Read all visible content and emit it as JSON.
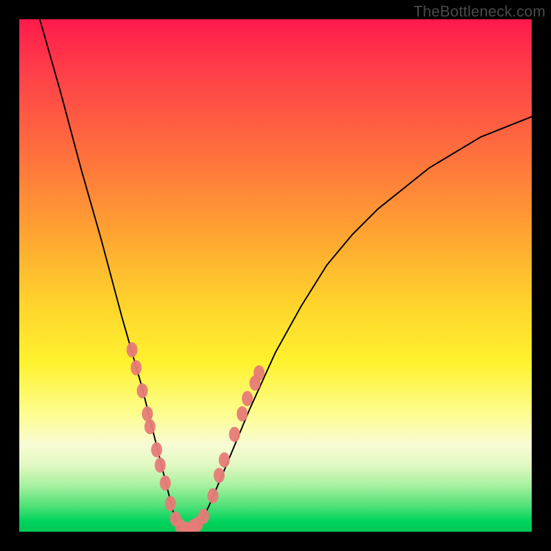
{
  "watermark": "TheBottleneck.com",
  "colors": {
    "frame": "#000000",
    "dot": "#e77b77",
    "curve": "#000000",
    "gradient_top": "#ff1a4b",
    "gradient_bottom": "#00c853"
  },
  "chart_data": {
    "type": "line",
    "title": "",
    "xlabel": "",
    "ylabel": "",
    "xlim": [
      0,
      100
    ],
    "ylim": [
      0,
      100
    ],
    "grid": false,
    "legend": false,
    "description": "V-shaped bottleneck curve over vertical red-to-green gradient; minimum near x≈31 where bottleneck is ~0. Curve values estimated from pixel heights. Pink dots mark sample points clustered on lower flanks and at the trough.",
    "series": [
      {
        "name": "bottleneck-curve",
        "x": [
          4,
          8,
          12,
          16,
          20,
          22,
          24,
          26,
          28,
          29,
          30,
          31,
          32,
          33,
          34,
          35,
          37,
          40,
          45,
          50,
          55,
          60,
          65,
          70,
          80,
          90,
          100
        ],
        "values": [
          100,
          86,
          71,
          57,
          42,
          35,
          28,
          20,
          12,
          8,
          4,
          1,
          0.3,
          0.2,
          0.4,
          1,
          5,
          12,
          24,
          35,
          44,
          52,
          58,
          63,
          71,
          77,
          81
        ]
      }
    ],
    "points": [
      {
        "x": 22.0,
        "y": 35.5
      },
      {
        "x": 22.8,
        "y": 32.0
      },
      {
        "x": 24.0,
        "y": 27.5
      },
      {
        "x": 25.0,
        "y": 23.0
      },
      {
        "x": 25.5,
        "y": 20.5
      },
      {
        "x": 26.8,
        "y": 16.0
      },
      {
        "x": 27.5,
        "y": 13.0
      },
      {
        "x": 28.5,
        "y": 9.5
      },
      {
        "x": 29.5,
        "y": 5.5
      },
      {
        "x": 30.5,
        "y": 2.5
      },
      {
        "x": 31.5,
        "y": 1.0
      },
      {
        "x": 32.5,
        "y": 0.5
      },
      {
        "x": 33.5,
        "y": 0.5
      },
      {
        "x": 34.0,
        "y": 1.0
      },
      {
        "x": 34.8,
        "y": 1.5
      },
      {
        "x": 36.0,
        "y": 3.0
      },
      {
        "x": 37.8,
        "y": 7.0
      },
      {
        "x": 39.0,
        "y": 11.0
      },
      {
        "x": 40.0,
        "y": 14.0
      },
      {
        "x": 42.0,
        "y": 19.0
      },
      {
        "x": 43.5,
        "y": 23.0
      },
      {
        "x": 44.5,
        "y": 26.0
      },
      {
        "x": 46.0,
        "y": 29.0
      },
      {
        "x": 46.8,
        "y": 31.0
      }
    ]
  }
}
